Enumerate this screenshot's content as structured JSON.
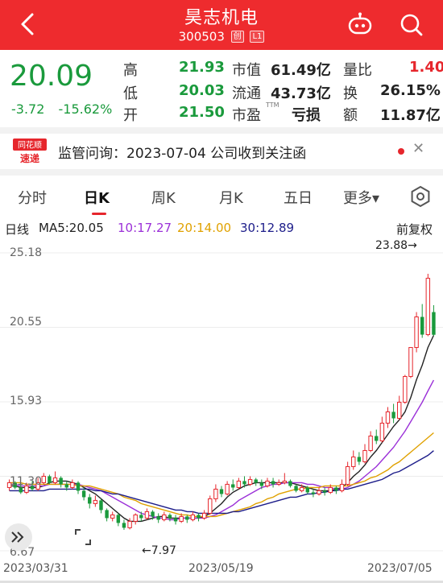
{
  "header": {
    "title": "昊志机电",
    "code": "300503",
    "tag1": "创",
    "tag2": "L1"
  },
  "quote": {
    "price": "20.09",
    "change": "-3.72",
    "change_pct": "-15.62%",
    "high_label": "高",
    "high": "21.93",
    "low_label": "低",
    "low": "20.03",
    "open_label": "开",
    "open": "21.50",
    "mktcap_label": "市值",
    "mktcap": "61.49亿",
    "float_label": "流通",
    "float": "43.73亿",
    "pe_label": "市盈",
    "pe_tag": "TTM",
    "pe": "亏损",
    "volratio_label": "量比",
    "volratio": "1.40",
    "turnover_label": "换",
    "turnover": "26.15%",
    "amount_label": "额",
    "amount": "11.87亿"
  },
  "notice": {
    "logo_top": "同花顺",
    "logo_bottom": "速递",
    "text": "监管问询：2023-07-04 公司收到关注函"
  },
  "tabs": [
    "分时",
    "日K",
    "周K",
    "月K",
    "五日",
    "更多▾"
  ],
  "ma": {
    "period_label": "日线",
    "ma5": "MA5:20.05",
    "ma10": "10:17.27",
    "ma20": "20:14.00",
    "ma30": "30:12.89",
    "adjust": "前复权"
  },
  "colors": {
    "up": "#e6262c",
    "down": "#1a9a3c",
    "ma5": "#222222",
    "ma10": "#9b30d8",
    "ma20": "#e0a100",
    "ma30": "#1d1d8a",
    "header": "#ee2b2e"
  },
  "chart": {
    "y_ticks": [
      "25.18",
      "20.55",
      "15.93",
      "11.30",
      "6.67"
    ],
    "x_ticks": [
      "2023/03/31",
      "2023/05/19",
      "2023/07/05"
    ],
    "max_label": "23.88→",
    "min_label": "←7.97"
  },
  "chart_data": {
    "type": "candlestick",
    "ylim": [
      6.67,
      25.18
    ],
    "x_range": [
      "2023/03/31",
      "2023/07/05"
    ],
    "highest": 23.88,
    "lowest": 7.97,
    "candles": [
      {
        "o": 10.6,
        "c": 10.9,
        "h": 11.1,
        "l": 10.4
      },
      {
        "o": 10.9,
        "c": 10.6,
        "h": 11.0,
        "l": 10.5
      },
      {
        "o": 10.6,
        "c": 10.3,
        "h": 10.8,
        "l": 10.2
      },
      {
        "o": 10.3,
        "c": 10.7,
        "h": 10.9,
        "l": 10.2
      },
      {
        "o": 10.7,
        "c": 10.5,
        "h": 11.0,
        "l": 10.4
      },
      {
        "o": 10.5,
        "c": 10.9,
        "h": 11.2,
        "l": 10.4
      },
      {
        "o": 10.9,
        "c": 11.3,
        "h": 11.5,
        "l": 10.8
      },
      {
        "o": 11.3,
        "c": 10.9,
        "h": 11.4,
        "l": 10.8
      },
      {
        "o": 10.9,
        "c": 11.2,
        "h": 11.6,
        "l": 10.8
      },
      {
        "o": 11.2,
        "c": 10.8,
        "h": 11.3,
        "l": 10.6
      },
      {
        "o": 10.8,
        "c": 10.6,
        "h": 11.0,
        "l": 10.4
      },
      {
        "o": 10.6,
        "c": 10.9,
        "h": 11.1,
        "l": 10.5
      },
      {
        "o": 10.9,
        "c": 10.4,
        "h": 11.0,
        "l": 10.2
      },
      {
        "o": 10.4,
        "c": 10.0,
        "h": 10.6,
        "l": 9.8
      },
      {
        "o": 10.0,
        "c": 9.6,
        "h": 10.2,
        "l": 9.3
      },
      {
        "o": 9.6,
        "c": 9.8,
        "h": 10.1,
        "l": 9.4
      },
      {
        "o": 9.8,
        "c": 9.2,
        "h": 9.9,
        "l": 9.0
      },
      {
        "o": 9.2,
        "c": 8.7,
        "h": 9.3,
        "l": 8.5
      },
      {
        "o": 8.7,
        "c": 8.9,
        "h": 9.1,
        "l": 8.5
      },
      {
        "o": 8.9,
        "c": 8.4,
        "h": 9.0,
        "l": 8.2
      },
      {
        "o": 8.4,
        "c": 8.1,
        "h": 8.6,
        "l": 7.97
      },
      {
        "o": 8.1,
        "c": 8.5,
        "h": 8.7,
        "l": 8.0
      },
      {
        "o": 8.5,
        "c": 8.9,
        "h": 9.0,
        "l": 8.3
      },
      {
        "o": 8.9,
        "c": 8.7,
        "h": 9.1,
        "l": 8.5
      },
      {
        "o": 8.7,
        "c": 9.1,
        "h": 9.3,
        "l": 8.6
      },
      {
        "o": 9.1,
        "c": 8.8,
        "h": 9.2,
        "l": 8.6
      },
      {
        "o": 8.8,
        "c": 8.6,
        "h": 9.0,
        "l": 8.4
      },
      {
        "o": 8.6,
        "c": 8.9,
        "h": 9.1,
        "l": 8.5
      },
      {
        "o": 8.9,
        "c": 8.7,
        "h": 9.0,
        "l": 8.5
      },
      {
        "o": 8.7,
        "c": 8.5,
        "h": 8.9,
        "l": 8.3
      },
      {
        "o": 8.5,
        "c": 8.8,
        "h": 9.0,
        "l": 8.4
      },
      {
        "o": 8.8,
        "c": 8.6,
        "h": 8.9,
        "l": 8.4
      },
      {
        "o": 8.6,
        "c": 8.9,
        "h": 9.1,
        "l": 8.5
      },
      {
        "o": 8.9,
        "c": 8.7,
        "h": 9.0,
        "l": 8.5
      },
      {
        "o": 8.7,
        "c": 9.0,
        "h": 9.2,
        "l": 8.6
      },
      {
        "o": 9.0,
        "c": 9.9,
        "h": 10.1,
        "l": 8.9
      },
      {
        "o": 9.9,
        "c": 10.5,
        "h": 10.8,
        "l": 9.7
      },
      {
        "o": 10.5,
        "c": 10.2,
        "h": 10.7,
        "l": 10.0
      },
      {
        "o": 10.2,
        "c": 10.8,
        "h": 11.0,
        "l": 10.1
      },
      {
        "o": 10.8,
        "c": 10.6,
        "h": 11.1,
        "l": 10.4
      },
      {
        "o": 10.6,
        "c": 11.0,
        "h": 11.2,
        "l": 10.5
      },
      {
        "o": 11.0,
        "c": 10.8,
        "h": 11.3,
        "l": 10.6
      },
      {
        "o": 10.8,
        "c": 11.1,
        "h": 11.3,
        "l": 10.7
      },
      {
        "o": 11.1,
        "c": 10.9,
        "h": 11.2,
        "l": 10.7
      },
      {
        "o": 10.9,
        "c": 10.7,
        "h": 11.1,
        "l": 10.5
      },
      {
        "o": 10.7,
        "c": 11.0,
        "h": 11.2,
        "l": 10.6
      },
      {
        "o": 11.0,
        "c": 10.8,
        "h": 11.2,
        "l": 10.6
      },
      {
        "o": 10.8,
        "c": 10.9,
        "h": 11.1,
        "l": 10.7
      },
      {
        "o": 10.9,
        "c": 11.0,
        "h": 11.5,
        "l": 10.8
      },
      {
        "o": 11.0,
        "c": 10.7,
        "h": 11.1,
        "l": 10.6
      },
      {
        "o": 10.7,
        "c": 10.4,
        "h": 10.8,
        "l": 10.3
      },
      {
        "o": 10.4,
        "c": 10.6,
        "h": 10.8,
        "l": 10.3
      },
      {
        "o": 10.6,
        "c": 10.3,
        "h": 10.7,
        "l": 10.2
      },
      {
        "o": 10.3,
        "c": 10.2,
        "h": 10.5,
        "l": 10.0
      },
      {
        "o": 10.2,
        "c": 10.4,
        "h": 10.6,
        "l": 10.1
      },
      {
        "o": 10.4,
        "c": 10.3,
        "h": 10.6,
        "l": 10.1
      },
      {
        "o": 10.3,
        "c": 10.6,
        "h": 10.8,
        "l": 10.2
      },
      {
        "o": 10.6,
        "c": 10.4,
        "h": 10.7,
        "l": 10.2
      },
      {
        "o": 10.4,
        "c": 10.8,
        "h": 11.1,
        "l": 10.3
      },
      {
        "o": 10.8,
        "c": 11.9,
        "h": 12.2,
        "l": 10.7
      },
      {
        "o": 11.9,
        "c": 12.5,
        "h": 12.9,
        "l": 11.7
      },
      {
        "o": 12.5,
        "c": 12.2,
        "h": 12.8,
        "l": 12.0
      },
      {
        "o": 12.2,
        "c": 12.9,
        "h": 13.3,
        "l": 12.1
      },
      {
        "o": 12.9,
        "c": 13.8,
        "h": 14.1,
        "l": 12.8
      },
      {
        "o": 13.8,
        "c": 13.5,
        "h": 14.2,
        "l": 13.3
      },
      {
        "o": 13.5,
        "c": 14.6,
        "h": 15.0,
        "l": 13.4
      },
      {
        "o": 14.6,
        "c": 15.3,
        "h": 15.6,
        "l": 14.3
      },
      {
        "o": 15.3,
        "c": 14.9,
        "h": 15.8,
        "l": 14.6
      },
      {
        "o": 14.9,
        "c": 15.9,
        "h": 16.3,
        "l": 14.8
      },
      {
        "o": 15.9,
        "c": 17.5,
        "h": 17.6,
        "l": 15.8
      },
      {
        "o": 17.5,
        "c": 19.3,
        "h": 19.3,
        "l": 17.4
      },
      {
        "o": 19.3,
        "c": 21.2,
        "h": 21.5,
        "l": 19.0
      },
      {
        "o": 21.2,
        "c": 20.1,
        "h": 22.0,
        "l": 19.9
      },
      {
        "o": 20.1,
        "c": 23.6,
        "h": 23.88,
        "l": 20.0
      },
      {
        "o": 21.5,
        "c": 20.09,
        "h": 21.93,
        "l": 20.03
      }
    ],
    "series": [
      {
        "name": "MA5",
        "values": [
          10.7,
          10.7,
          10.6,
          10.6,
          10.6,
          10.6,
          10.7,
          10.9,
          11.0,
          11.0,
          11.0,
          10.9,
          10.8,
          10.6,
          10.4,
          10.2,
          9.9,
          9.6,
          9.3,
          9.0,
          8.7,
          8.5,
          8.5,
          8.5,
          8.6,
          8.7,
          8.8,
          8.8,
          8.7,
          8.7,
          8.7,
          8.7,
          8.7,
          8.7,
          8.8,
          9.0,
          9.3,
          9.6,
          10.0,
          10.3,
          10.5,
          10.7,
          10.8,
          10.9,
          10.9,
          10.9,
          10.9,
          10.9,
          10.9,
          10.9,
          10.8,
          10.7,
          10.6,
          10.5,
          10.4,
          10.4,
          10.4,
          10.5,
          10.6,
          10.9,
          11.3,
          11.6,
          12.0,
          12.5,
          12.9,
          13.4,
          13.9,
          14.4,
          14.8,
          15.3,
          16.2,
          17.3,
          18.2,
          19.3,
          20.05
        ]
      },
      {
        "name": "MA10",
        "values": [
          10.8,
          10.8,
          10.7,
          10.7,
          10.7,
          10.7,
          10.7,
          10.8,
          10.8,
          10.8,
          10.8,
          10.8,
          10.8,
          10.7,
          10.6,
          10.5,
          10.4,
          10.2,
          10.0,
          9.8,
          9.6,
          9.4,
          9.2,
          9.0,
          8.9,
          8.8,
          8.7,
          8.7,
          8.6,
          8.6,
          8.7,
          8.7,
          8.7,
          8.7,
          8.7,
          8.8,
          8.9,
          9.1,
          9.3,
          9.5,
          9.8,
          10.0,
          10.2,
          10.4,
          10.6,
          10.7,
          10.8,
          10.8,
          10.9,
          10.9,
          10.9,
          10.9,
          10.8,
          10.8,
          10.7,
          10.6,
          10.6,
          10.5,
          10.5,
          10.6,
          10.8,
          11.0,
          11.3,
          11.6,
          11.9,
          12.3,
          12.7,
          13.1,
          13.6,
          14.1,
          14.7,
          15.3,
          15.9,
          16.6,
          17.27
        ]
      },
      {
        "name": "MA20",
        "values": [
          10.9,
          10.9,
          10.9,
          10.8,
          10.8,
          10.8,
          10.8,
          10.8,
          10.8,
          10.8,
          10.8,
          10.8,
          10.7,
          10.7,
          10.7,
          10.6,
          10.5,
          10.4,
          10.3,
          10.2,
          10.0,
          9.9,
          9.8,
          9.6,
          9.5,
          9.4,
          9.3,
          9.2,
          9.1,
          9.0,
          8.9,
          8.9,
          8.8,
          8.8,
          8.8,
          8.8,
          8.8,
          8.9,
          9.0,
          9.1,
          9.2,
          9.3,
          9.4,
          9.6,
          9.7,
          9.9,
          10.0,
          10.2,
          10.3,
          10.4,
          10.5,
          10.5,
          10.6,
          10.6,
          10.6,
          10.7,
          10.7,
          10.7,
          10.7,
          10.7,
          10.8,
          10.9,
          11.0,
          11.2,
          11.3,
          11.5,
          11.7,
          12.0,
          12.2,
          12.5,
          12.8,
          13.1,
          13.4,
          13.7,
          14.0
        ]
      },
      {
        "name": "MA30",
        "values": [
          10.4,
          10.4,
          10.4,
          10.4,
          10.4,
          10.4,
          10.4,
          10.5,
          10.5,
          10.5,
          10.5,
          10.5,
          10.5,
          10.5,
          10.5,
          10.4,
          10.4,
          10.3,
          10.2,
          10.2,
          10.1,
          10.0,
          9.9,
          9.8,
          9.7,
          9.6,
          9.5,
          9.4,
          9.3,
          9.2,
          9.2,
          9.1,
          9.1,
          9.0,
          9.0,
          9.0,
          9.0,
          9.0,
          9.0,
          9.1,
          9.1,
          9.2,
          9.3,
          9.4,
          9.5,
          9.6,
          9.7,
          9.8,
          9.9,
          10.0,
          10.0,
          10.1,
          10.2,
          10.2,
          10.3,
          10.3,
          10.4,
          10.4,
          10.5,
          10.5,
          10.6,
          10.7,
          10.8,
          10.9,
          11.0,
          11.1,
          11.3,
          11.5,
          11.6,
          11.8,
          12.0,
          12.2,
          12.4,
          12.6,
          12.89
        ]
      }
    ]
  }
}
